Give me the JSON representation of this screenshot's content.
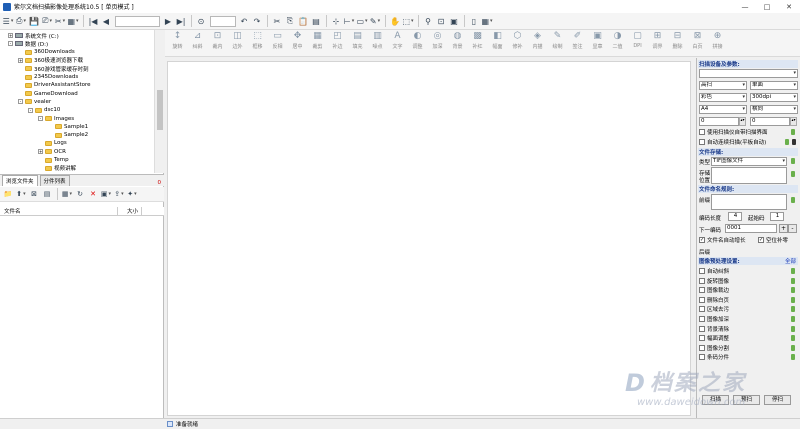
{
  "window": {
    "title": "紫尔文档扫描影像处理系统10.5 [ 单页模式 ]",
    "controls": [
      "—",
      "□",
      "✕"
    ]
  },
  "toolbar_main": {
    "icons": [
      "menu-icon",
      "scan-icon",
      "save-icon",
      "print-icon",
      "tools-icon",
      "grid-icon"
    ],
    "nav": [
      "|◀",
      "◀",
      "▶",
      "▶|"
    ]
  },
  "toolbar_tools": [
    {
      "icon": "↕",
      "label": "旋转"
    },
    {
      "icon": "⊿",
      "label": "纠斜"
    },
    {
      "icon": "⊡",
      "label": "裁内"
    },
    {
      "icon": "◫",
      "label": "边外"
    },
    {
      "icon": "⬚",
      "label": "框移"
    },
    {
      "icon": "▭",
      "label": "反相"
    },
    {
      "icon": "✥",
      "label": "居中"
    },
    {
      "icon": "▦",
      "label": "裁剪"
    },
    {
      "icon": "◰",
      "label": "补边"
    },
    {
      "icon": "▤",
      "label": "填充"
    },
    {
      "icon": "▥",
      "label": "噪点"
    },
    {
      "icon": "A",
      "label": "文字"
    },
    {
      "icon": "◐",
      "label": "调整"
    },
    {
      "icon": "◎",
      "label": "加深"
    },
    {
      "icon": "◍",
      "label": "背景"
    },
    {
      "icon": "▩",
      "label": "补红"
    },
    {
      "icon": "◧",
      "label": "幅面"
    },
    {
      "icon": "⬡",
      "label": "修补"
    },
    {
      "icon": "◈",
      "label": "内描"
    },
    {
      "icon": "✎",
      "label": "绘制"
    },
    {
      "icon": "✐",
      "label": "签注"
    },
    {
      "icon": "▣",
      "label": "显章"
    },
    {
      "icon": "◑",
      "label": "二值"
    },
    {
      "icon": "▢",
      "label": "DPI"
    },
    {
      "icon": "⊞",
      "label": "调界"
    },
    {
      "icon": "⊟",
      "label": "删除"
    },
    {
      "icon": "⊠",
      "label": "白页"
    },
    {
      "icon": "⊕",
      "label": "拼接"
    }
  ],
  "tree": [
    {
      "label": "系统文件 (C:)",
      "depth": 0,
      "type": "drive",
      "exp": "+"
    },
    {
      "label": "数据 (D:)",
      "depth": 0,
      "type": "drive",
      "exp": "-"
    },
    {
      "label": "360Downloads",
      "depth": 1,
      "type": "folder",
      "exp": ""
    },
    {
      "label": "360极速浏览器下载",
      "depth": 1,
      "type": "folder",
      "exp": "+"
    },
    {
      "label": "360游戏管家缓存时刻",
      "depth": 1,
      "type": "folder",
      "exp": ""
    },
    {
      "label": "2345Downloads",
      "depth": 1,
      "type": "folder",
      "exp": ""
    },
    {
      "label": "DriverAssistantStore",
      "depth": 1,
      "type": "folder",
      "exp": ""
    },
    {
      "label": "GameDownload",
      "depth": 1,
      "type": "folder",
      "exp": ""
    },
    {
      "label": "vealer",
      "depth": 1,
      "type": "folder",
      "exp": "-"
    },
    {
      "label": "dsc10",
      "depth": 2,
      "type": "folder",
      "exp": "-"
    },
    {
      "label": "Images",
      "depth": 3,
      "type": "folder",
      "exp": "-"
    },
    {
      "label": "Sample1",
      "depth": 4,
      "type": "folder",
      "exp": ""
    },
    {
      "label": "Sample2",
      "depth": 4,
      "type": "folder",
      "exp": ""
    },
    {
      "label": "Logs",
      "depth": 3,
      "type": "folder",
      "exp": ""
    },
    {
      "label": "OCR",
      "depth": 3,
      "type": "folder",
      "exp": "+"
    },
    {
      "label": "Temp",
      "depth": 3,
      "type": "folder",
      "exp": ""
    },
    {
      "label": "视频讲解",
      "depth": 3,
      "type": "folder",
      "exp": ""
    }
  ],
  "left_tabs": {
    "browse": "浏览文件夹",
    "batch": "分件列表",
    "count": "0"
  },
  "file_list": {
    "col_name": "文件名",
    "col_size": "大小"
  },
  "right_panel": {
    "scan_section": "扫描设备及参数:",
    "device": "",
    "quality": "高扫",
    "side": "单面",
    "color": "彩色",
    "dpi": "300dpi",
    "paper": "A4",
    "orient": "横向",
    "val1": "0",
    "val2": "0",
    "chk_ui": "使用扫描仪自带扫描界面",
    "chk_auto": "自动连续扫描(平板自动)",
    "file_section": "文件存储:",
    "type_label": "类型",
    "type_value": "TIF图像文件",
    "store_label1": "存储",
    "store_label2": "位置",
    "name_section": "文件命名规则:",
    "prefix_label": "前缀",
    "code_len_label": "编码长度",
    "code_len": "4",
    "start_label": "起始码",
    "start_val": "1",
    "next_label": "下一编码",
    "next_val": "0001",
    "plus": "+",
    "minus": "-",
    "chk_auto_inc": "文件名自动增长",
    "chk_space": "空位补零",
    "suffix_label": "后缀",
    "pre_section": "图像预处理设置:",
    "select_all": "全部",
    "pre_items": [
      "自动纠斜",
      "旋转图像",
      "图像裁边",
      "删除白页",
      "区域去污",
      "图像加深",
      "背景清除",
      "幅面调整",
      "图像分割",
      "条码分件"
    ],
    "btn_scan": "扫描",
    "btn_prev": "预扫",
    "btn_stop": "停扫"
  },
  "status": {
    "text": "准备就绪"
  },
  "watermark": {
    "logo": "D",
    "cn": "档案之家",
    "url": "www.daweidown.com"
  }
}
